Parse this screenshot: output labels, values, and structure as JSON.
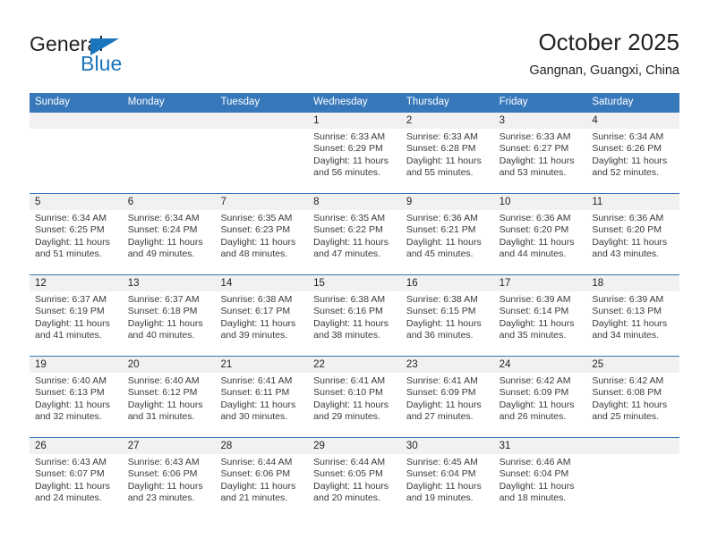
{
  "brand": {
    "name_part1": "General",
    "name_part2": "Blue",
    "triangle_color": "#1b75bc"
  },
  "header": {
    "title": "October 2025",
    "subtitle": "Gangnan, Guangxi, China",
    "accent_color": "#3778bb",
    "date_band_color": "#f1f1f1"
  },
  "weekdays": [
    "Sunday",
    "Monday",
    "Tuesday",
    "Wednesday",
    "Thursday",
    "Friday",
    "Saturday"
  ],
  "weeks": [
    {
      "days": [
        {
          "date": "",
          "sunrise": "",
          "sunset": "",
          "daylight_line1": "",
          "daylight_line2": ""
        },
        {
          "date": "",
          "sunrise": "",
          "sunset": "",
          "daylight_line1": "",
          "daylight_line2": ""
        },
        {
          "date": "",
          "sunrise": "",
          "sunset": "",
          "daylight_line1": "",
          "daylight_line2": ""
        },
        {
          "date": "1",
          "sunrise": "Sunrise: 6:33 AM",
          "sunset": "Sunset: 6:29 PM",
          "daylight_line1": "Daylight: 11 hours",
          "daylight_line2": "and 56 minutes."
        },
        {
          "date": "2",
          "sunrise": "Sunrise: 6:33 AM",
          "sunset": "Sunset: 6:28 PM",
          "daylight_line1": "Daylight: 11 hours",
          "daylight_line2": "and 55 minutes."
        },
        {
          "date": "3",
          "sunrise": "Sunrise: 6:33 AM",
          "sunset": "Sunset: 6:27 PM",
          "daylight_line1": "Daylight: 11 hours",
          "daylight_line2": "and 53 minutes."
        },
        {
          "date": "4",
          "sunrise": "Sunrise: 6:34 AM",
          "sunset": "Sunset: 6:26 PM",
          "daylight_line1": "Daylight: 11 hours",
          "daylight_line2": "and 52 minutes."
        }
      ]
    },
    {
      "days": [
        {
          "date": "5",
          "sunrise": "Sunrise: 6:34 AM",
          "sunset": "Sunset: 6:25 PM",
          "daylight_line1": "Daylight: 11 hours",
          "daylight_line2": "and 51 minutes."
        },
        {
          "date": "6",
          "sunrise": "Sunrise: 6:34 AM",
          "sunset": "Sunset: 6:24 PM",
          "daylight_line1": "Daylight: 11 hours",
          "daylight_line2": "and 49 minutes."
        },
        {
          "date": "7",
          "sunrise": "Sunrise: 6:35 AM",
          "sunset": "Sunset: 6:23 PM",
          "daylight_line1": "Daylight: 11 hours",
          "daylight_line2": "and 48 minutes."
        },
        {
          "date": "8",
          "sunrise": "Sunrise: 6:35 AM",
          "sunset": "Sunset: 6:22 PM",
          "daylight_line1": "Daylight: 11 hours",
          "daylight_line2": "and 47 minutes."
        },
        {
          "date": "9",
          "sunrise": "Sunrise: 6:36 AM",
          "sunset": "Sunset: 6:21 PM",
          "daylight_line1": "Daylight: 11 hours",
          "daylight_line2": "and 45 minutes."
        },
        {
          "date": "10",
          "sunrise": "Sunrise: 6:36 AM",
          "sunset": "Sunset: 6:20 PM",
          "daylight_line1": "Daylight: 11 hours",
          "daylight_line2": "and 44 minutes."
        },
        {
          "date": "11",
          "sunrise": "Sunrise: 6:36 AM",
          "sunset": "Sunset: 6:20 PM",
          "daylight_line1": "Daylight: 11 hours",
          "daylight_line2": "and 43 minutes."
        }
      ]
    },
    {
      "days": [
        {
          "date": "12",
          "sunrise": "Sunrise: 6:37 AM",
          "sunset": "Sunset: 6:19 PM",
          "daylight_line1": "Daylight: 11 hours",
          "daylight_line2": "and 41 minutes."
        },
        {
          "date": "13",
          "sunrise": "Sunrise: 6:37 AM",
          "sunset": "Sunset: 6:18 PM",
          "daylight_line1": "Daylight: 11 hours",
          "daylight_line2": "and 40 minutes."
        },
        {
          "date": "14",
          "sunrise": "Sunrise: 6:38 AM",
          "sunset": "Sunset: 6:17 PM",
          "daylight_line1": "Daylight: 11 hours",
          "daylight_line2": "and 39 minutes."
        },
        {
          "date": "15",
          "sunrise": "Sunrise: 6:38 AM",
          "sunset": "Sunset: 6:16 PM",
          "daylight_line1": "Daylight: 11 hours",
          "daylight_line2": "and 38 minutes."
        },
        {
          "date": "16",
          "sunrise": "Sunrise: 6:38 AM",
          "sunset": "Sunset: 6:15 PM",
          "daylight_line1": "Daylight: 11 hours",
          "daylight_line2": "and 36 minutes."
        },
        {
          "date": "17",
          "sunrise": "Sunrise: 6:39 AM",
          "sunset": "Sunset: 6:14 PM",
          "daylight_line1": "Daylight: 11 hours",
          "daylight_line2": "and 35 minutes."
        },
        {
          "date": "18",
          "sunrise": "Sunrise: 6:39 AM",
          "sunset": "Sunset: 6:13 PM",
          "daylight_line1": "Daylight: 11 hours",
          "daylight_line2": "and 34 minutes."
        }
      ]
    },
    {
      "days": [
        {
          "date": "19",
          "sunrise": "Sunrise: 6:40 AM",
          "sunset": "Sunset: 6:13 PM",
          "daylight_line1": "Daylight: 11 hours",
          "daylight_line2": "and 32 minutes."
        },
        {
          "date": "20",
          "sunrise": "Sunrise: 6:40 AM",
          "sunset": "Sunset: 6:12 PM",
          "daylight_line1": "Daylight: 11 hours",
          "daylight_line2": "and 31 minutes."
        },
        {
          "date": "21",
          "sunrise": "Sunrise: 6:41 AM",
          "sunset": "Sunset: 6:11 PM",
          "daylight_line1": "Daylight: 11 hours",
          "daylight_line2": "and 30 minutes."
        },
        {
          "date": "22",
          "sunrise": "Sunrise: 6:41 AM",
          "sunset": "Sunset: 6:10 PM",
          "daylight_line1": "Daylight: 11 hours",
          "daylight_line2": "and 29 minutes."
        },
        {
          "date": "23",
          "sunrise": "Sunrise: 6:41 AM",
          "sunset": "Sunset: 6:09 PM",
          "daylight_line1": "Daylight: 11 hours",
          "daylight_line2": "and 27 minutes."
        },
        {
          "date": "24",
          "sunrise": "Sunrise: 6:42 AM",
          "sunset": "Sunset: 6:09 PM",
          "daylight_line1": "Daylight: 11 hours",
          "daylight_line2": "and 26 minutes."
        },
        {
          "date": "25",
          "sunrise": "Sunrise: 6:42 AM",
          "sunset": "Sunset: 6:08 PM",
          "daylight_line1": "Daylight: 11 hours",
          "daylight_line2": "and 25 minutes."
        }
      ]
    },
    {
      "days": [
        {
          "date": "26",
          "sunrise": "Sunrise: 6:43 AM",
          "sunset": "Sunset: 6:07 PM",
          "daylight_line1": "Daylight: 11 hours",
          "daylight_line2": "and 24 minutes."
        },
        {
          "date": "27",
          "sunrise": "Sunrise: 6:43 AM",
          "sunset": "Sunset: 6:06 PM",
          "daylight_line1": "Daylight: 11 hours",
          "daylight_line2": "and 23 minutes."
        },
        {
          "date": "28",
          "sunrise": "Sunrise: 6:44 AM",
          "sunset": "Sunset: 6:06 PM",
          "daylight_line1": "Daylight: 11 hours",
          "daylight_line2": "and 21 minutes."
        },
        {
          "date": "29",
          "sunrise": "Sunrise: 6:44 AM",
          "sunset": "Sunset: 6:05 PM",
          "daylight_line1": "Daylight: 11 hours",
          "daylight_line2": "and 20 minutes."
        },
        {
          "date": "30",
          "sunrise": "Sunrise: 6:45 AM",
          "sunset": "Sunset: 6:04 PM",
          "daylight_line1": "Daylight: 11 hours",
          "daylight_line2": "and 19 minutes."
        },
        {
          "date": "31",
          "sunrise": "Sunrise: 6:46 AM",
          "sunset": "Sunset: 6:04 PM",
          "daylight_line1": "Daylight: 11 hours",
          "daylight_line2": "and 18 minutes."
        },
        {
          "date": "",
          "sunrise": "",
          "sunset": "",
          "daylight_line1": "",
          "daylight_line2": ""
        }
      ]
    }
  ]
}
